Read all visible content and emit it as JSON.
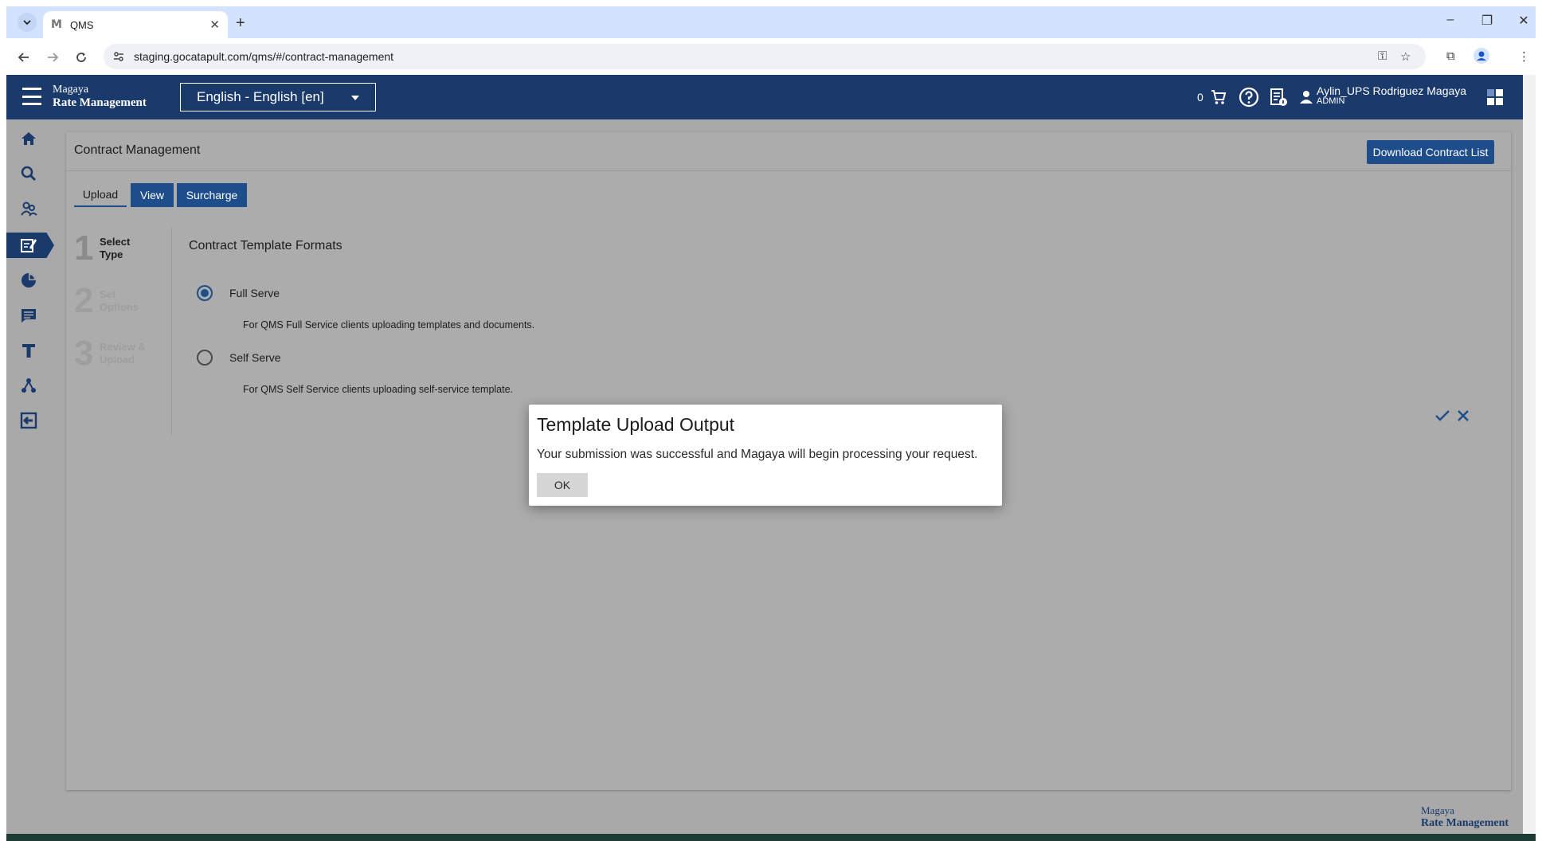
{
  "browser": {
    "tab_title": "QMS",
    "tab_favicon": "M",
    "url": "staging.gocatapult.com/qms/#/contract-management"
  },
  "header": {
    "brand_line1": "Magaya",
    "brand_line2": "Rate Management",
    "language": "English - English [en]",
    "cart_count": "0",
    "user_name": "Aylin_UPS Rodriguez Magaya",
    "user_role": "ADMIN"
  },
  "page": {
    "title": "Contract Management",
    "download_button": "Download Contract List",
    "tabs": [
      {
        "label": "Upload"
      },
      {
        "label": "View"
      },
      {
        "label": "Surcharge"
      }
    ],
    "steps": [
      {
        "number": "1",
        "label": "Select Type"
      },
      {
        "number": "2",
        "label": "Set Options"
      },
      {
        "number": "3",
        "label": "Review & Upload"
      }
    ],
    "section_title": "Contract Template Formats",
    "options": [
      {
        "label": "Full Serve",
        "description": "For QMS Full Service clients uploading templates and documents.",
        "selected": true
      },
      {
        "label": "Self Serve",
        "description": "For QMS Self Service clients uploading self-service template.",
        "selected": false
      }
    ]
  },
  "dialog": {
    "title": "Template Upload Output",
    "message": "Your submission was successful and Magaya will begin processing your request.",
    "ok_label": "OK"
  },
  "footer": {
    "brand_line1": "Magaya",
    "brand_line2": "Rate Management"
  },
  "colors": {
    "navy": "#1a3a6b",
    "button_blue": "#1e4d8c",
    "overlay_gray": "#a9a9a9"
  }
}
